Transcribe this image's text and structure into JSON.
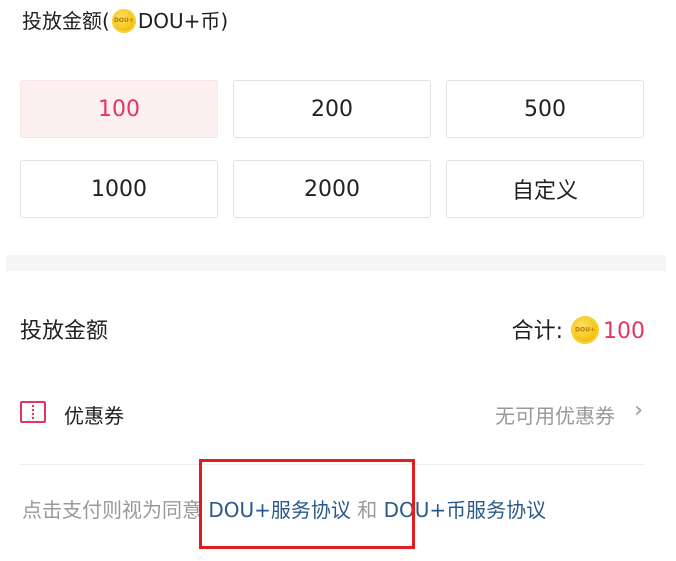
{
  "header": {
    "prefix": "投放金额(",
    "currency": "DOU+币)",
    "coin_icon": "dou-coin-icon"
  },
  "amounts": [
    {
      "label": "100",
      "selected": true
    },
    {
      "label": "200",
      "selected": false
    },
    {
      "label": "500",
      "selected": false
    },
    {
      "label": "1000",
      "selected": false
    },
    {
      "label": "2000",
      "selected": false
    },
    {
      "label": "自定义",
      "selected": false
    }
  ],
  "summary": {
    "label": "投放金额",
    "total_prefix": "合计:",
    "total_value": "100"
  },
  "coupon": {
    "label": "优惠券",
    "status": "无可用优惠券",
    "icon": "coupon-ticket-icon"
  },
  "agreement": {
    "prefix": "点击支付则视为同意 ",
    "link1": "DOU+服务协议",
    "connector": " 和 ",
    "link2": "DOU+币服务协议"
  },
  "colors": {
    "accent": "#e5355e",
    "selected_bg": "#fdf0f1",
    "link": "#2a5a8a",
    "muted": "#999999",
    "highlight_box": "#e21d1d"
  }
}
